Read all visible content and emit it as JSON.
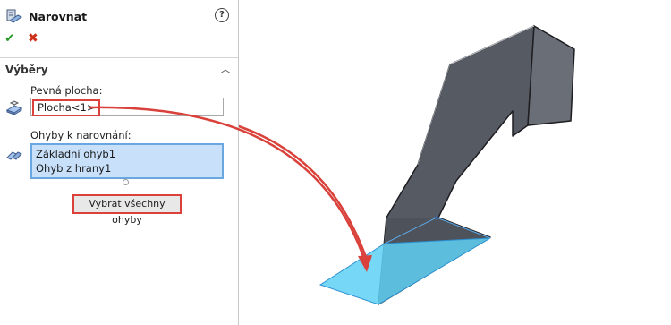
{
  "header": {
    "title": "Narovnat",
    "help": "?"
  },
  "actions": {
    "ok": "✔",
    "cancel": "✖"
  },
  "section": {
    "title": "Výběry",
    "fixed_face_label": "Pevná plocha:",
    "fixed_face_value": "Plocha<1>",
    "bends_label": "Ohyby k narovnání:",
    "bends": [
      "Základní ohyb1",
      "Ohyb z hrany1"
    ],
    "select_all_label": "Vybrat všechny ohyby"
  },
  "colors": {
    "annotation_red": "#d9413a",
    "highlight_blue": "#5fd0f5",
    "part_gray": "#5b5f66"
  },
  "icons": {
    "header": "flatten-sheetmetal-icon",
    "help": "help-icon",
    "fixed_face": "fixed-face-icon",
    "bends": "bends-icon",
    "collapse": "chevron-up-icon"
  }
}
